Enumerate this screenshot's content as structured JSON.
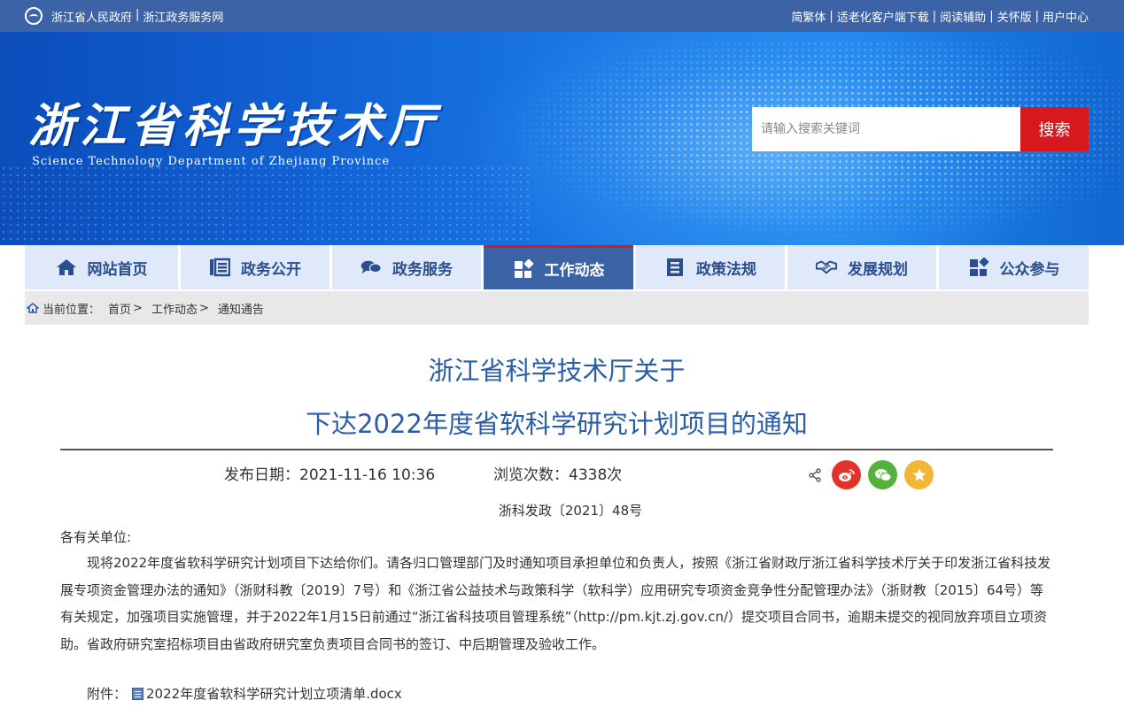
{
  "topbar": {
    "left_links": [
      "浙江省人民政府",
      "浙江政务服务网"
    ],
    "right_links": [
      "简繁体",
      "适老化客户端下载",
      "阅读辅助",
      "关怀版",
      "用户中心"
    ]
  },
  "banner": {
    "logo_cn": "浙江省科学技术厅",
    "logo_en": "Science Technology Department of Zhejiang Province"
  },
  "search": {
    "placeholder": "请输入搜索关键词",
    "button": "搜索"
  },
  "nav": {
    "items": [
      {
        "label": "网站首页",
        "icon": "home-icon"
      },
      {
        "label": "政务公开",
        "icon": "list-icon"
      },
      {
        "label": "政务服务",
        "icon": "chat-icon"
      },
      {
        "label": "工作动态",
        "icon": "diamond-grid-icon",
        "active": true
      },
      {
        "label": "政策法规",
        "icon": "document-icon"
      },
      {
        "label": "发展规划",
        "icon": "handshake-icon"
      },
      {
        "label": "公众参与",
        "icon": "diamond-grid-icon"
      }
    ]
  },
  "breadcrumb": {
    "prefix": "当前位置：",
    "items": [
      "首页",
      "工作动态",
      "通知通告"
    ],
    "separator": ">"
  },
  "article": {
    "title_line1": "浙江省科学技术厅关于",
    "title_line2": "下达2022年度省软科学研究计划项目的通知",
    "date_label": "发布日期：2021-11-16 10:36",
    "views_label": "浏览次数：4338次",
    "doc_number": "浙科发政〔2021〕48号",
    "salutation": "各有关单位:",
    "body": "现将2022年度省软科学研究计划项目下达给你们。请各归口管理部门及时通知项目承担单位和负责人，按照《浙江省财政厅浙江省科学技术厅关于印发浙江省科技发展专项资金管理办法的通知》（浙财科教〔2019〕7号）和《浙江省公益技术与政策科学（软科学）应用研究专项资金竞争性分配管理办法》（浙财教〔2015〕64号）等有关规定，加强项目实施管理，并于2022年1月15日前通过“浙江省科技项目管理系统”（http://pm.kjt.zj.gov.cn/）提交项目合同书，逾期未提交的视同放弃项目立项资助。省政府研究室招标项目由省政府研究室负责项目合同书的签订、中后期管理及验收工作。",
    "attachment_label": "附件：",
    "attachment_file": "2022年度省软科学研究计划立项清单.docx"
  },
  "colors": {
    "topbar": "#3c63a6",
    "title": "#2a5da8",
    "search_button": "#d7191f",
    "nav_bg": "#dfe9f9",
    "nav_active": "#3c63a6"
  }
}
